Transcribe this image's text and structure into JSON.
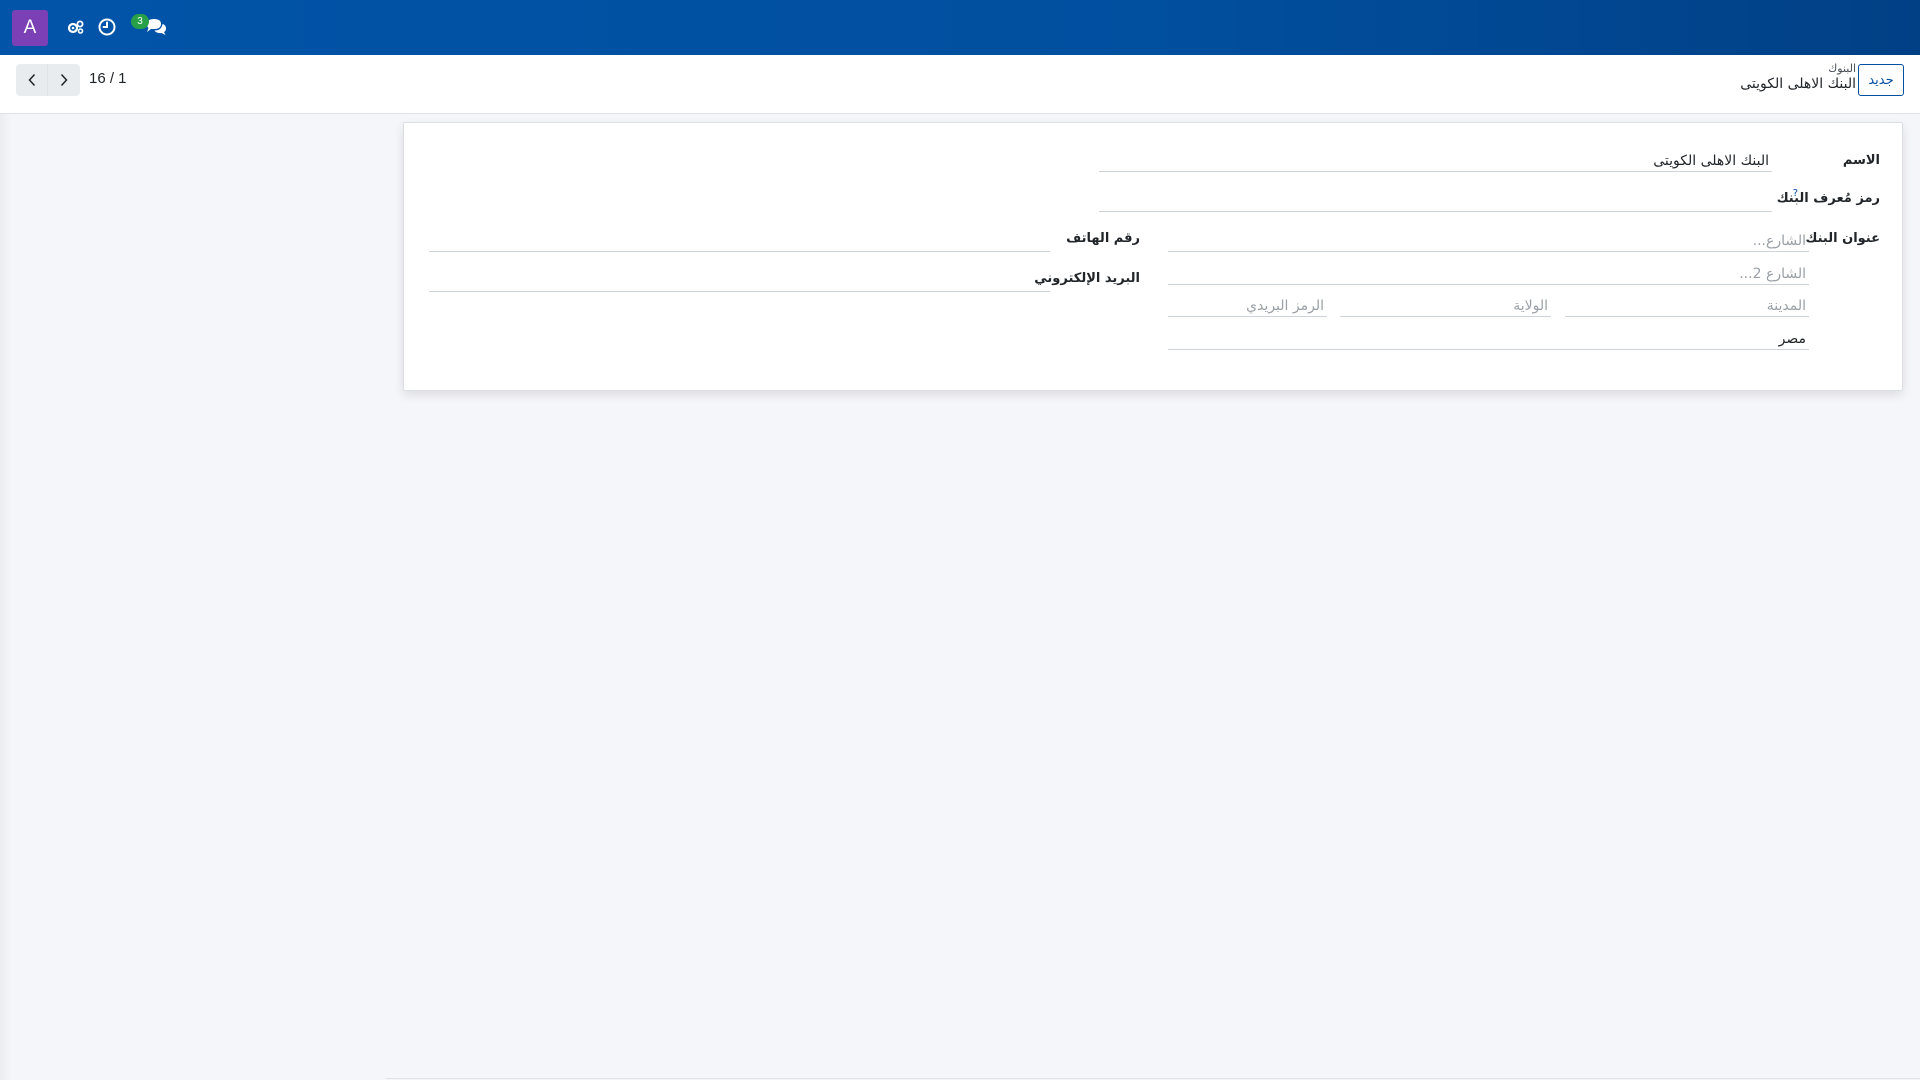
{
  "navbar": {
    "avatar_letter": "A",
    "icons": [
      "settings-gears-icon",
      "clock-activity-icon",
      "chat-messages-icon"
    ],
    "messages_badge": "3",
    "colors": {
      "bar": "#0154a8",
      "avatar": "#7b3fb6",
      "badge": "#27a048"
    }
  },
  "control_panel": {
    "new_button_label": "جديد",
    "breadcrumb_parent": "البنوك",
    "breadcrumb_current": "البنك الاهلى الكويتى",
    "pager_text": "16 / 1"
  },
  "form": {
    "name_label": "الاسم",
    "name_value": "البنك الاهلى الكويتى",
    "bic_label": "رمز مُعرف البنك",
    "bic_help": "?",
    "bic_value": "",
    "address_label": "عنوان البنك",
    "street_placeholder": "الشارع...",
    "street2_placeholder": "الشارع 2...",
    "city_placeholder": "المدينة",
    "state_placeholder": "الولاية",
    "zip_placeholder": "الرمز البريدي",
    "country_value": "مصر",
    "phone_label": "رقم الهاتف",
    "phone_value": "",
    "email_label": "البريد الإلكتروني",
    "email_value": ""
  }
}
